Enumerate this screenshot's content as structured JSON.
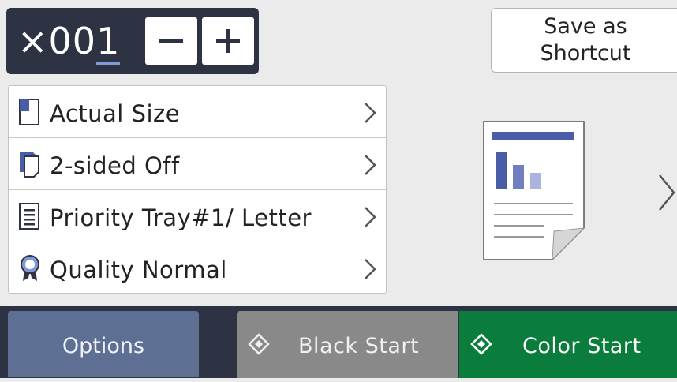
{
  "copies": {
    "prefix": "×00",
    "last_digit": "1",
    "minus_label": "−",
    "plus_label": "+"
  },
  "save_shortcut": {
    "line1": "Save as",
    "line2": "Shortcut"
  },
  "settings": [
    {
      "label": "Actual Size",
      "icon": "page-size-icon"
    },
    {
      "label": "2-sided Off",
      "icon": "duplex-icon"
    },
    {
      "label": "Priority Tray#1/ Letter",
      "icon": "tray-icon"
    },
    {
      "label": "Quality Normal",
      "icon": "quality-ribbon-icon"
    }
  ],
  "bottom": {
    "options_label": "Options",
    "black_start_label": "Black Start",
    "color_start_label": "Color Start"
  },
  "colors": {
    "dark_panel": "#2d3342",
    "options_bg": "#5e6f94",
    "black_start_bg": "#898989",
    "color_start_bg": "#0a7c3c",
    "accent_blue": "#4a5ea8"
  }
}
